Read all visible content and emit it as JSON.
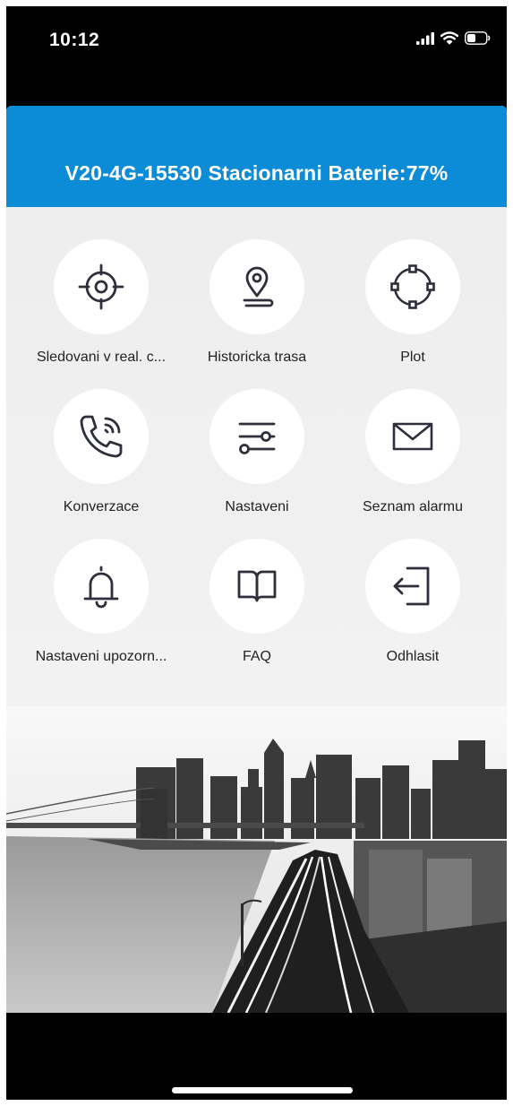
{
  "status_bar": {
    "time": "10:12",
    "icons": [
      "cellular-signal-icon",
      "wifi-icon",
      "battery-icon"
    ]
  },
  "header": {
    "title": "V20-4G-15530 Stacionarni Baterie:77%",
    "background_color": "#0c8bd7"
  },
  "menu": [
    {
      "label": "Sledovani v real. c...",
      "icon": "crosshair-icon"
    },
    {
      "label": "Historicka trasa",
      "icon": "map-pin-route-icon"
    },
    {
      "label": "Plot",
      "icon": "geofence-icon"
    },
    {
      "label": "Konverzace",
      "icon": "phone-call-icon"
    },
    {
      "label": "Nastaveni",
      "icon": "sliders-icon"
    },
    {
      "label": "Seznam alarmu",
      "icon": "envelope-icon"
    },
    {
      "label": "Nastaveni upozorn...",
      "icon": "bell-icon"
    },
    {
      "label": "FAQ",
      "icon": "book-icon"
    },
    {
      "label": "Odhlasit",
      "icon": "logout-icon"
    }
  ],
  "colors": {
    "icon_stroke": "#2d2f3a",
    "label_text": "#222222",
    "app_background": "#f0f0f0"
  }
}
